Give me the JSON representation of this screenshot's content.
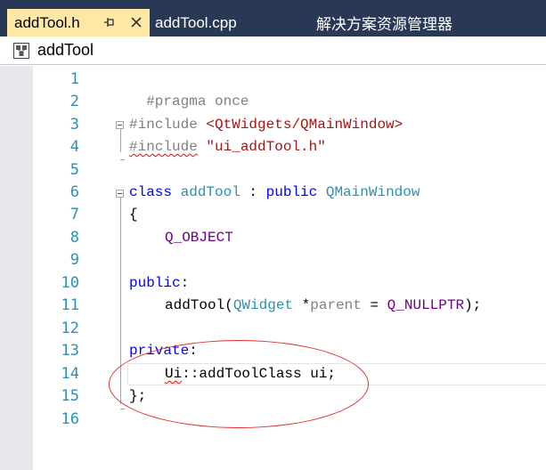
{
  "tabs": [
    {
      "label": "addTool.h",
      "active": true
    },
    {
      "label": "addTool.cpp",
      "active": false
    },
    {
      "label": "解决方案资源管理器",
      "active": false
    }
  ],
  "icons": {
    "pin": "pin-icon",
    "close": "close-icon",
    "class_member": "class-icon"
  },
  "navbar": {
    "label": "addTool"
  },
  "line_numbers": [
    "1",
    "2",
    "3",
    "4",
    "5",
    "6",
    "7",
    "8",
    "9",
    "10",
    "11",
    "12",
    "13",
    "14",
    "15",
    "16"
  ],
  "code": {
    "l1": {
      "pp": "#pragma once"
    },
    "l3": {
      "pp": "#include ",
      "str": "<QtWidgets/QMainWindow>"
    },
    "l4": {
      "pp": "#include",
      "space": " ",
      "str": "\"ui_addTool.h\""
    },
    "l6": {
      "kw1": "class",
      "name": " addTool",
      "colon": " : ",
      "kw2": "public",
      "base": " QMainWindow"
    },
    "l7": {
      "text": "{"
    },
    "l8": {
      "macro": "Q_OBJECT"
    },
    "l10": {
      "kw": "public",
      "colon": ":"
    },
    "l11": {
      "fn": "addTool(",
      "type": "QWidget",
      "star": " *",
      "param": "parent",
      "eq": " = ",
      "macro": "Q_NULLPTR",
      "end": ");"
    },
    "l13": {
      "kw": "private",
      "colon": ":"
    },
    "l14": {
      "ns": "Ui",
      "rest": "::addToolClass ui;"
    },
    "l15": {
      "text": "};"
    }
  },
  "colors": {
    "tab_strip": "#293955",
    "active_tab": "#ffe8a6",
    "line_number": "#2b91af",
    "keyword": "#0000ff",
    "string": "#a31515",
    "type": "#2b91af",
    "macro": "#6f008a",
    "preprocessor": "#808080",
    "annotation": "#e03030"
  }
}
